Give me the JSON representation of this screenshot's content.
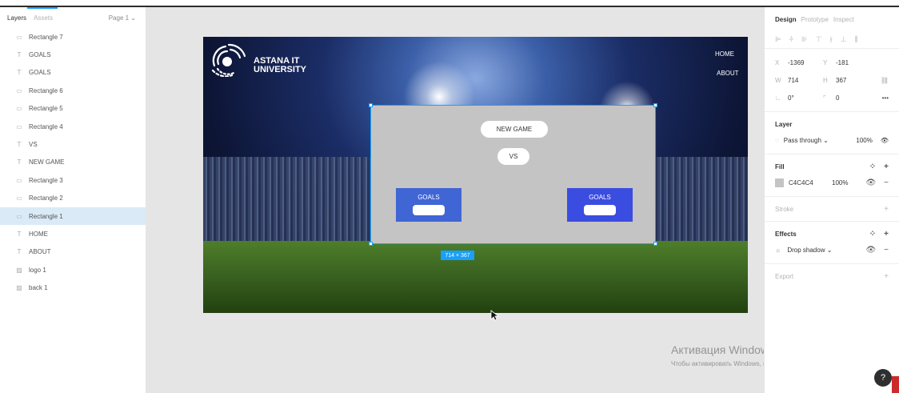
{
  "left_panel": {
    "tabs": [
      "Layers",
      "Assets"
    ],
    "page": "Page 1 ⌄",
    "layers": [
      {
        "icon": "rect-icon",
        "glyph": "▭",
        "label": "Rectangle 7"
      },
      {
        "icon": "text-icon",
        "glyph": "T",
        "label": "GOALS"
      },
      {
        "icon": "text-icon",
        "glyph": "T",
        "label": "GOALS"
      },
      {
        "icon": "rect-icon",
        "glyph": "▭",
        "label": "Rectangle 6"
      },
      {
        "icon": "rect-icon",
        "glyph": "▭",
        "label": "Rectangle 5"
      },
      {
        "icon": "rect-icon",
        "glyph": "▭",
        "label": "Rectangle 4"
      },
      {
        "icon": "text-icon",
        "glyph": "T",
        "label": "VS"
      },
      {
        "icon": "text-icon",
        "glyph": "T",
        "label": "NEW GAME"
      },
      {
        "icon": "rect-icon",
        "glyph": "▭",
        "label": "Rectangle 3"
      },
      {
        "icon": "rect-icon",
        "glyph": "▭",
        "label": "Rectangle 2"
      },
      {
        "icon": "rect-icon",
        "glyph": "▭",
        "label": "Rectangle 1",
        "selected": true
      },
      {
        "icon": "text-icon",
        "glyph": "T",
        "label": "HOME"
      },
      {
        "icon": "text-icon",
        "glyph": "T",
        "label": "ABOUT"
      },
      {
        "icon": "image-icon",
        "glyph": "▨",
        "label": "logo 1"
      },
      {
        "icon": "image-icon",
        "glyph": "▨",
        "label": "back 1"
      }
    ]
  },
  "frame": {
    "logo_line1": "ASTANA IT",
    "logo_line2": "UNIVERSITY",
    "nav_home": "HOME",
    "nav_about": "ABOUT",
    "new_game": "NEW GAME",
    "vs": "VS",
    "goals_left": "GOALS",
    "goals_right": "GOALS",
    "size_badge": "714 × 367"
  },
  "colors": {
    "selection": "#18a0fb",
    "rect_fill": "#c4c4c4",
    "goal_left": "#4065d4",
    "goal_right": "#3a4de0"
  },
  "right_panel": {
    "tabs": [
      "Design",
      "Prototype",
      "Inspect"
    ],
    "x_label": "X",
    "x": "-1369",
    "y_label": "Y",
    "y": "-181",
    "w_label": "W",
    "w": "714",
    "h_label": "H",
    "h": "367",
    "rotation": "0°",
    "radius": "0",
    "layer_title": "Layer",
    "blend": "Pass through ⌄",
    "opacity": "100%",
    "fill_title": "Fill",
    "fill_hex": "C4C4C4",
    "fill_opacity": "100%",
    "stroke_title": "Stroke",
    "effects_title": "Effects",
    "effect": "Drop shadow ⌄",
    "export_title": "Export"
  },
  "watermark": {
    "title": "Активация Windows",
    "sub": "Чтобы активировать Windows, перейдите в раздел \"Параметры\"."
  },
  "help": "?"
}
